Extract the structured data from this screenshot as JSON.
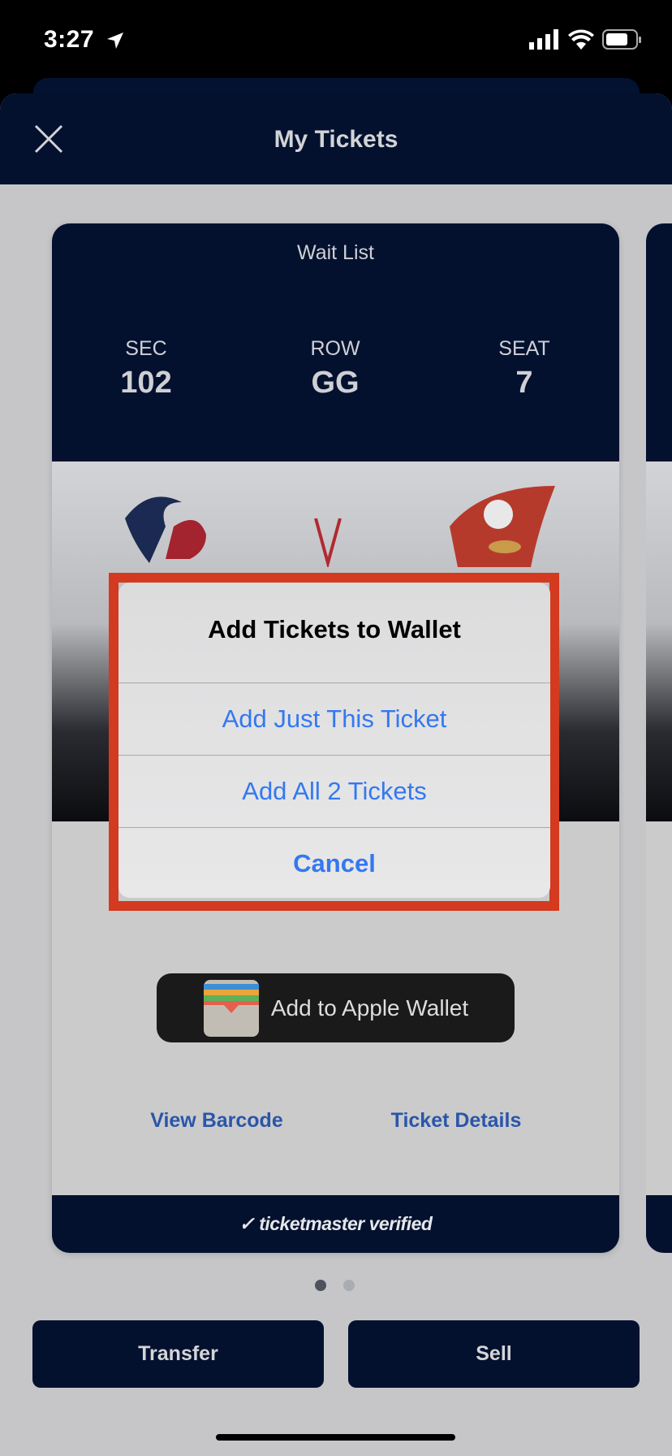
{
  "status_bar": {
    "time": "3:27",
    "icons": [
      "location-arrow-icon",
      "signal-icon",
      "wifi-icon",
      "battery-icon"
    ]
  },
  "header": {
    "title": "My Tickets",
    "close_icon": "close-icon"
  },
  "ticket": {
    "label": "Wait List",
    "columns": [
      {
        "label": "SEC",
        "value": "102"
      },
      {
        "label": "ROW",
        "value": "GG"
      },
      {
        "label": "SEAT",
        "value": "7"
      }
    ],
    "wallet_button": "Add to Apple Wallet",
    "view_barcode": "View Barcode",
    "ticket_details": "Ticket Details",
    "verified": "ticketmaster verified"
  },
  "pagination": {
    "current": 1,
    "total": 2
  },
  "actions": {
    "transfer": "Transfer",
    "sell": "Sell"
  },
  "alert": {
    "title": "Add Tickets to Wallet",
    "options": [
      "Add Just This Ticket",
      "Add All 2 Tickets"
    ],
    "cancel": "Cancel"
  },
  "colors": {
    "navy": "#03112f",
    "highlight": "#d33a1f",
    "ios_blue": "#3478f0",
    "link": "#2a56a8"
  }
}
